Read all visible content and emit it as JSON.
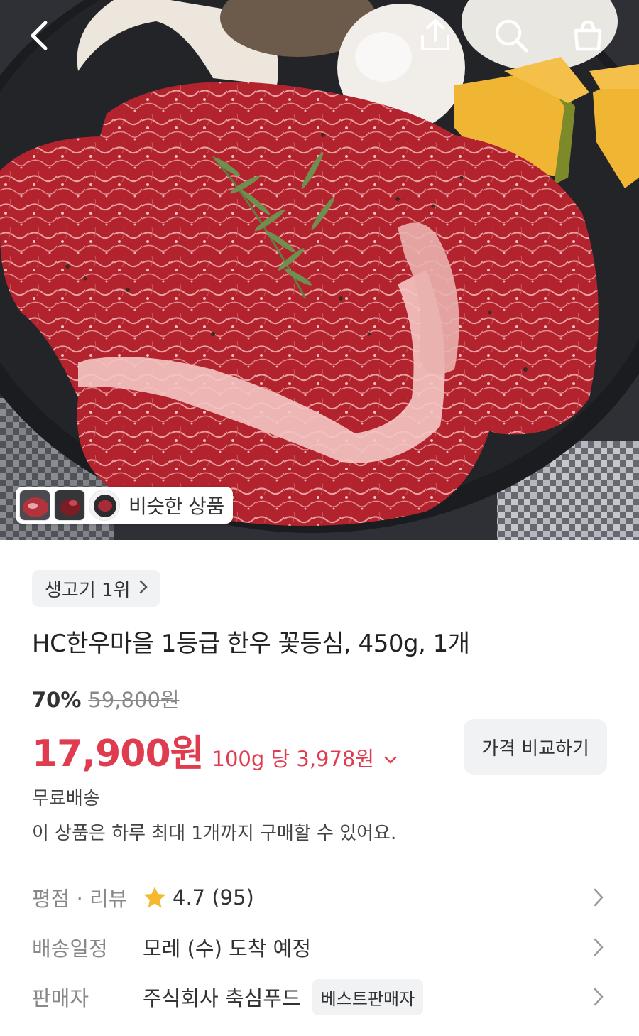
{
  "topbar": {
    "back_icon": "chevron-left-icon",
    "share_icon": "share-icon",
    "search_icon": "search-icon",
    "cart_icon": "shopping-bag-icon"
  },
  "similar": {
    "label": "비슷한 상품"
  },
  "rank_chip": {
    "label": "생고기 1위"
  },
  "product": {
    "title": "HC한우마을 1등급 한우 꽃등심, 450g, 1개",
    "discount": "70%",
    "original_price": "59,800원",
    "sale_price": "17,900원",
    "unit_price": "100g 당 3,978원",
    "compare_label": "가격 비교하기",
    "shipping": "무료배송",
    "limit_notice": "이 상품은 하루 최대 1개까지 구매할 수 있어요."
  },
  "details": {
    "rating_label": "평점 · 리뷰",
    "rating_value": "4.7 (95)",
    "delivery_label": "배송일정",
    "delivery_value": "모레 (수) 도착 예정",
    "seller_label": "판매자",
    "seller_value": "주식회사 축심푸드",
    "seller_badge": "베스트판매자"
  },
  "colors": {
    "accent_red": "#e03c50",
    "star": "#f5b82e",
    "chip_bg": "#f1f2f4"
  }
}
